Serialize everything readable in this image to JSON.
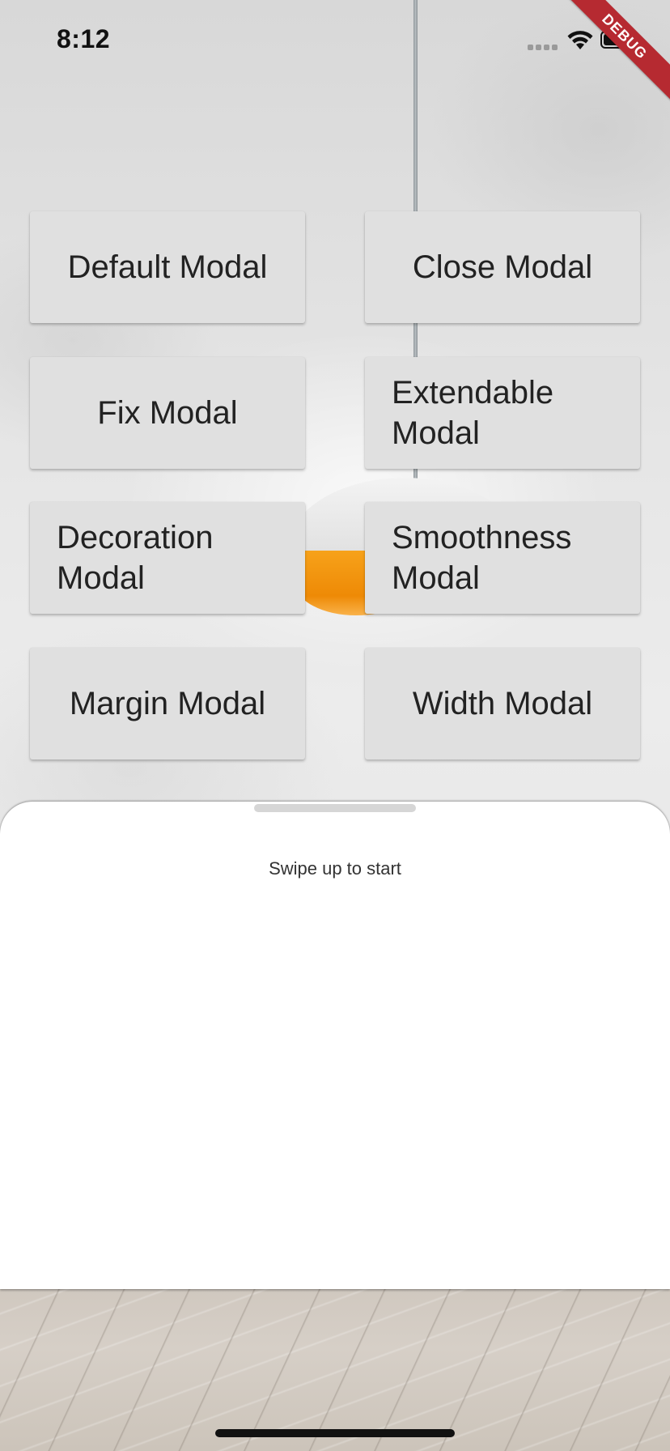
{
  "status_bar": {
    "time": "8:12",
    "icons": [
      "cellular-signal-icon",
      "wifi-icon",
      "battery-icon"
    ]
  },
  "debug_banner": {
    "label": "DEBUG",
    "color": "#b62a31"
  },
  "buttons": {
    "default_modal": "Default Modal",
    "close_modal": "Close Modal",
    "fix_modal": "Fix Modal",
    "extendable_modal": "Extendable Modal",
    "decoration_modal": "Decoration Modal",
    "smoothness_modal": "Smoothness Modal",
    "margin_modal": "Margin Modal",
    "width_modal": "Width Modal"
  },
  "sheet": {
    "hint": "Swipe up to start"
  },
  "colors": {
    "button_bg": "#e0e0e0",
    "button_text": "#222222",
    "sheet_bg": "#ffffff",
    "lamp_accent": "#f29214"
  }
}
